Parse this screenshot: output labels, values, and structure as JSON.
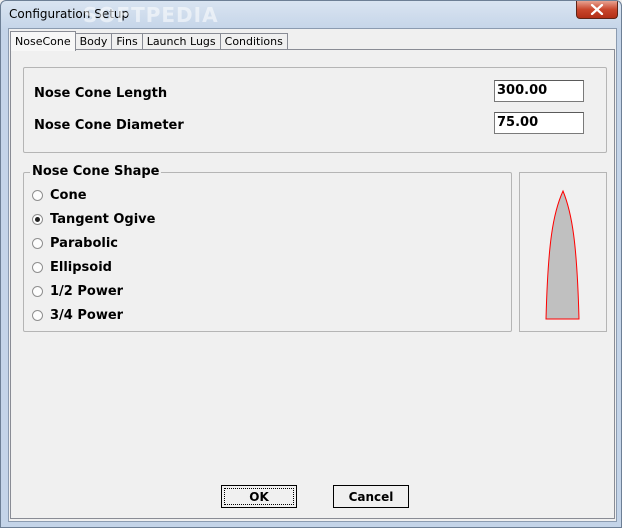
{
  "window": {
    "title": "Configuration Setup",
    "watermark": "SOFTPEDIA"
  },
  "tabs": [
    {
      "label": "NoseCone",
      "active": true
    },
    {
      "label": "Body",
      "active": false
    },
    {
      "label": "Fins",
      "active": false
    },
    {
      "label": "Launch Lugs",
      "active": false
    },
    {
      "label": "Conditions",
      "active": false
    }
  ],
  "fields": {
    "length_label": "Nose Cone Length",
    "length_value": "300.00",
    "diameter_label": "Nose Cone Diameter",
    "diameter_value": "75.00"
  },
  "shape_group": {
    "legend": "Nose Cone Shape",
    "options": [
      {
        "label": "Cone",
        "selected": false
      },
      {
        "label": "Tangent Ogive",
        "selected": true
      },
      {
        "label": "Parabolic",
        "selected": false
      },
      {
        "label": "Ellipsoid",
        "selected": false
      },
      {
        "label": "1/2 Power",
        "selected": false
      },
      {
        "label": "3/4 Power",
        "selected": false
      }
    ]
  },
  "preview": {
    "fill_color": "#c0c0c0",
    "stroke_color": "#ff0000"
  },
  "buttons": {
    "ok": "OK",
    "cancel": "Cancel"
  },
  "colors": {
    "close_button": "#c9462c"
  }
}
